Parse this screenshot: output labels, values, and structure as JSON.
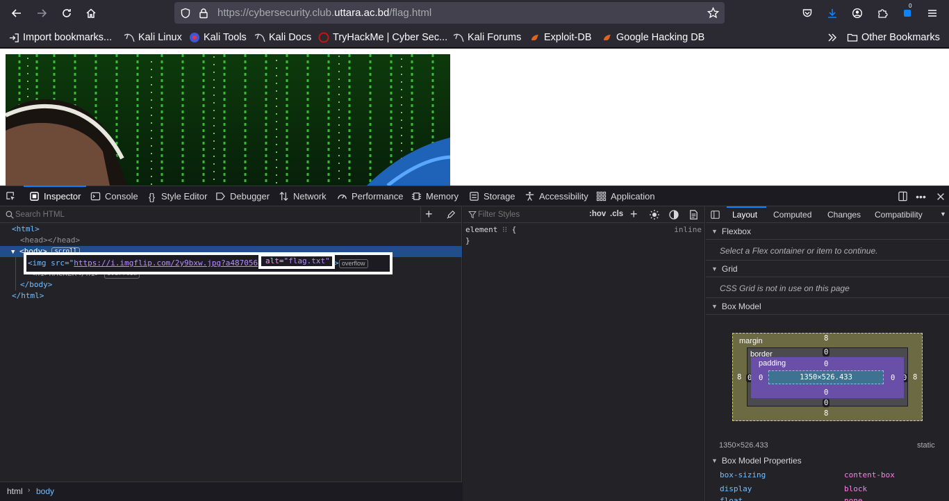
{
  "browser": {
    "url_prefix": "https://cybersecurity.club.",
    "url_domain": "uttara.ac.bd",
    "url_path": "/flag.html",
    "downloads_badge": "0",
    "bookmarks": [
      {
        "label": "Import bookmarks...",
        "icon": "import-icon"
      },
      {
        "label": "Kali Linux",
        "icon": "kali-icon"
      },
      {
        "label": "Kali Tools",
        "icon": "kali-tools-icon"
      },
      {
        "label": "Kali Docs",
        "icon": "kali-icon"
      },
      {
        "label": "TryHackMe | Cyber Sec...",
        "icon": "tryhackme-icon"
      },
      {
        "label": "Kali Forums",
        "icon": "kali-icon"
      },
      {
        "label": "Exploit-DB",
        "icon": "exploit-db-icon"
      },
      {
        "label": "Google Hacking DB",
        "icon": "exploit-db-icon"
      }
    ],
    "other_bookmarks": "Other Bookmarks"
  },
  "devtools": {
    "tabs": [
      {
        "label": "Inspector",
        "icon": "inspector-icon",
        "active": true
      },
      {
        "label": "Console",
        "icon": "console-icon"
      },
      {
        "label": "Style Editor",
        "icon": "braces-icon"
      },
      {
        "label": "Debugger",
        "icon": "debugger-icon"
      },
      {
        "label": "Network",
        "icon": "network-icon"
      },
      {
        "label": "Performance",
        "icon": "performance-icon"
      },
      {
        "label": "Memory",
        "icon": "memory-icon"
      },
      {
        "label": "Storage",
        "icon": "storage-icon"
      },
      {
        "label": "Accessibility",
        "icon": "accessibility-icon"
      },
      {
        "label": "Application",
        "icon": "application-icon"
      }
    ],
    "html_pane": {
      "search_placeholder": "Search HTML",
      "lines": {
        "html_open": "<html>",
        "head": "<head></head>",
        "body_open": "<body>",
        "body_badge": "scroll",
        "img_prefix": "<img src=\"",
        "img_src": "https://i.imgflip.com/2y9bxw.jpg?a487056",
        "img_alt_attr": "alt",
        "img_alt_value": "\"flag.txt\"",
        "img_suffix": ">",
        "img_badge": "overflow",
        "h1_line": "<h1>HACKER</h1>",
        "h1_badge": "overflow",
        "body_close": "</body>",
        "html_close": "</html>"
      },
      "breadcrumb": [
        "html",
        "body"
      ]
    },
    "styles_pane": {
      "filter_placeholder": "Filter Styles",
      "hov": ":hov",
      "cls": ".cls",
      "rule_selector": "element",
      "rule_open": "{",
      "rule_close": "}",
      "rule_source": "inline"
    },
    "layout_pane": {
      "tabs": [
        "Layout",
        "Computed",
        "Changes",
        "Compatibility"
      ],
      "active_tab": "Layout",
      "flexbox_title": "Flexbox",
      "flexbox_note": "Select a Flex container or item to continue.",
      "grid_title": "Grid",
      "grid_note": "CSS Grid is not in use on this page",
      "boxmodel_title": "Box Model",
      "boxmodel": {
        "margin_label": "margin",
        "border_label": "border",
        "padding_label": "padding",
        "content": "1350×526.433",
        "margin": {
          "top": "8",
          "right": "8",
          "bottom": "8",
          "left": "8"
        },
        "border": {
          "top": "0",
          "right": "0",
          "bottom": "0",
          "left": "0"
        },
        "padding": {
          "top": "0",
          "right": "0",
          "bottom": "0",
          "left": "0"
        }
      },
      "dimensions": "1350×526.433",
      "position": "static",
      "props_title": "Box Model Properties",
      "props": [
        {
          "name": "box-sizing",
          "value": "content-box"
        },
        {
          "name": "display",
          "value": "block"
        },
        {
          "name": "float",
          "value": "none"
        }
      ]
    },
    "colors": {
      "margin_bg": "#6b6a42",
      "border_bg": "#444444",
      "padding_bg": "#6a4fa8",
      "content_bg": "#3d7391"
    }
  }
}
